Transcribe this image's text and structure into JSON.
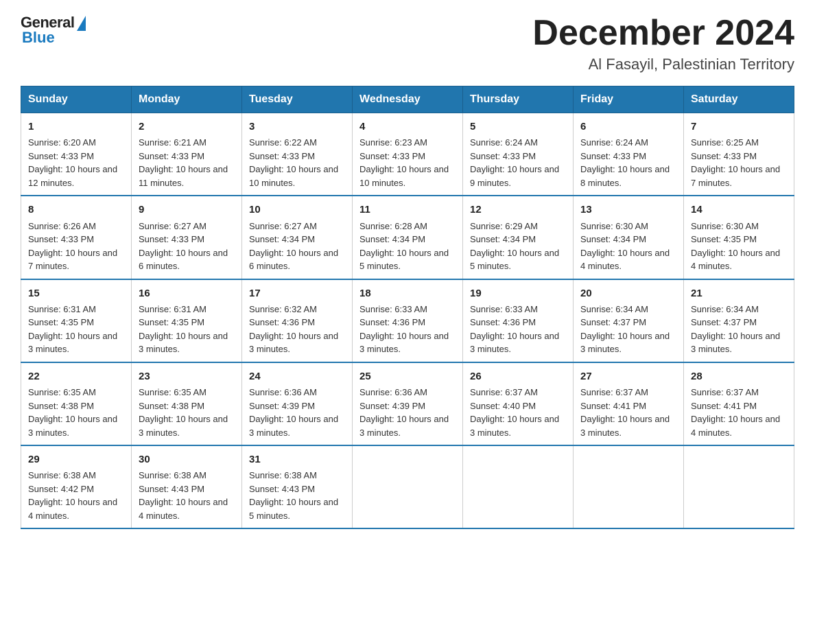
{
  "header": {
    "logo_general": "General",
    "logo_blue": "Blue",
    "month_title": "December 2024",
    "subtitle": "Al Fasayil, Palestinian Territory"
  },
  "weekdays": [
    "Sunday",
    "Monday",
    "Tuesday",
    "Wednesday",
    "Thursday",
    "Friday",
    "Saturday"
  ],
  "weeks": [
    [
      {
        "day": "1",
        "sunrise": "Sunrise: 6:20 AM",
        "sunset": "Sunset: 4:33 PM",
        "daylight": "Daylight: 10 hours and 12 minutes."
      },
      {
        "day": "2",
        "sunrise": "Sunrise: 6:21 AM",
        "sunset": "Sunset: 4:33 PM",
        "daylight": "Daylight: 10 hours and 11 minutes."
      },
      {
        "day": "3",
        "sunrise": "Sunrise: 6:22 AM",
        "sunset": "Sunset: 4:33 PM",
        "daylight": "Daylight: 10 hours and 10 minutes."
      },
      {
        "day": "4",
        "sunrise": "Sunrise: 6:23 AM",
        "sunset": "Sunset: 4:33 PM",
        "daylight": "Daylight: 10 hours and 10 minutes."
      },
      {
        "day": "5",
        "sunrise": "Sunrise: 6:24 AM",
        "sunset": "Sunset: 4:33 PM",
        "daylight": "Daylight: 10 hours and 9 minutes."
      },
      {
        "day": "6",
        "sunrise": "Sunrise: 6:24 AM",
        "sunset": "Sunset: 4:33 PM",
        "daylight": "Daylight: 10 hours and 8 minutes."
      },
      {
        "day": "7",
        "sunrise": "Sunrise: 6:25 AM",
        "sunset": "Sunset: 4:33 PM",
        "daylight": "Daylight: 10 hours and 7 minutes."
      }
    ],
    [
      {
        "day": "8",
        "sunrise": "Sunrise: 6:26 AM",
        "sunset": "Sunset: 4:33 PM",
        "daylight": "Daylight: 10 hours and 7 minutes."
      },
      {
        "day": "9",
        "sunrise": "Sunrise: 6:27 AM",
        "sunset": "Sunset: 4:33 PM",
        "daylight": "Daylight: 10 hours and 6 minutes."
      },
      {
        "day": "10",
        "sunrise": "Sunrise: 6:27 AM",
        "sunset": "Sunset: 4:34 PM",
        "daylight": "Daylight: 10 hours and 6 minutes."
      },
      {
        "day": "11",
        "sunrise": "Sunrise: 6:28 AM",
        "sunset": "Sunset: 4:34 PM",
        "daylight": "Daylight: 10 hours and 5 minutes."
      },
      {
        "day": "12",
        "sunrise": "Sunrise: 6:29 AM",
        "sunset": "Sunset: 4:34 PM",
        "daylight": "Daylight: 10 hours and 5 minutes."
      },
      {
        "day": "13",
        "sunrise": "Sunrise: 6:30 AM",
        "sunset": "Sunset: 4:34 PM",
        "daylight": "Daylight: 10 hours and 4 minutes."
      },
      {
        "day": "14",
        "sunrise": "Sunrise: 6:30 AM",
        "sunset": "Sunset: 4:35 PM",
        "daylight": "Daylight: 10 hours and 4 minutes."
      }
    ],
    [
      {
        "day": "15",
        "sunrise": "Sunrise: 6:31 AM",
        "sunset": "Sunset: 4:35 PM",
        "daylight": "Daylight: 10 hours and 3 minutes."
      },
      {
        "day": "16",
        "sunrise": "Sunrise: 6:31 AM",
        "sunset": "Sunset: 4:35 PM",
        "daylight": "Daylight: 10 hours and 3 minutes."
      },
      {
        "day": "17",
        "sunrise": "Sunrise: 6:32 AM",
        "sunset": "Sunset: 4:36 PM",
        "daylight": "Daylight: 10 hours and 3 minutes."
      },
      {
        "day": "18",
        "sunrise": "Sunrise: 6:33 AM",
        "sunset": "Sunset: 4:36 PM",
        "daylight": "Daylight: 10 hours and 3 minutes."
      },
      {
        "day": "19",
        "sunrise": "Sunrise: 6:33 AM",
        "sunset": "Sunset: 4:36 PM",
        "daylight": "Daylight: 10 hours and 3 minutes."
      },
      {
        "day": "20",
        "sunrise": "Sunrise: 6:34 AM",
        "sunset": "Sunset: 4:37 PM",
        "daylight": "Daylight: 10 hours and 3 minutes."
      },
      {
        "day": "21",
        "sunrise": "Sunrise: 6:34 AM",
        "sunset": "Sunset: 4:37 PM",
        "daylight": "Daylight: 10 hours and 3 minutes."
      }
    ],
    [
      {
        "day": "22",
        "sunrise": "Sunrise: 6:35 AM",
        "sunset": "Sunset: 4:38 PM",
        "daylight": "Daylight: 10 hours and 3 minutes."
      },
      {
        "day": "23",
        "sunrise": "Sunrise: 6:35 AM",
        "sunset": "Sunset: 4:38 PM",
        "daylight": "Daylight: 10 hours and 3 minutes."
      },
      {
        "day": "24",
        "sunrise": "Sunrise: 6:36 AM",
        "sunset": "Sunset: 4:39 PM",
        "daylight": "Daylight: 10 hours and 3 minutes."
      },
      {
        "day": "25",
        "sunrise": "Sunrise: 6:36 AM",
        "sunset": "Sunset: 4:39 PM",
        "daylight": "Daylight: 10 hours and 3 minutes."
      },
      {
        "day": "26",
        "sunrise": "Sunrise: 6:37 AM",
        "sunset": "Sunset: 4:40 PM",
        "daylight": "Daylight: 10 hours and 3 minutes."
      },
      {
        "day": "27",
        "sunrise": "Sunrise: 6:37 AM",
        "sunset": "Sunset: 4:41 PM",
        "daylight": "Daylight: 10 hours and 3 minutes."
      },
      {
        "day": "28",
        "sunrise": "Sunrise: 6:37 AM",
        "sunset": "Sunset: 4:41 PM",
        "daylight": "Daylight: 10 hours and 4 minutes."
      }
    ],
    [
      {
        "day": "29",
        "sunrise": "Sunrise: 6:38 AM",
        "sunset": "Sunset: 4:42 PM",
        "daylight": "Daylight: 10 hours and 4 minutes."
      },
      {
        "day": "30",
        "sunrise": "Sunrise: 6:38 AM",
        "sunset": "Sunset: 4:43 PM",
        "daylight": "Daylight: 10 hours and 4 minutes."
      },
      {
        "day": "31",
        "sunrise": "Sunrise: 6:38 AM",
        "sunset": "Sunset: 4:43 PM",
        "daylight": "Daylight: 10 hours and 5 minutes."
      },
      {
        "day": "",
        "sunrise": "",
        "sunset": "",
        "daylight": ""
      },
      {
        "day": "",
        "sunrise": "",
        "sunset": "",
        "daylight": ""
      },
      {
        "day": "",
        "sunrise": "",
        "sunset": "",
        "daylight": ""
      },
      {
        "day": "",
        "sunrise": "",
        "sunset": "",
        "daylight": ""
      }
    ]
  ]
}
